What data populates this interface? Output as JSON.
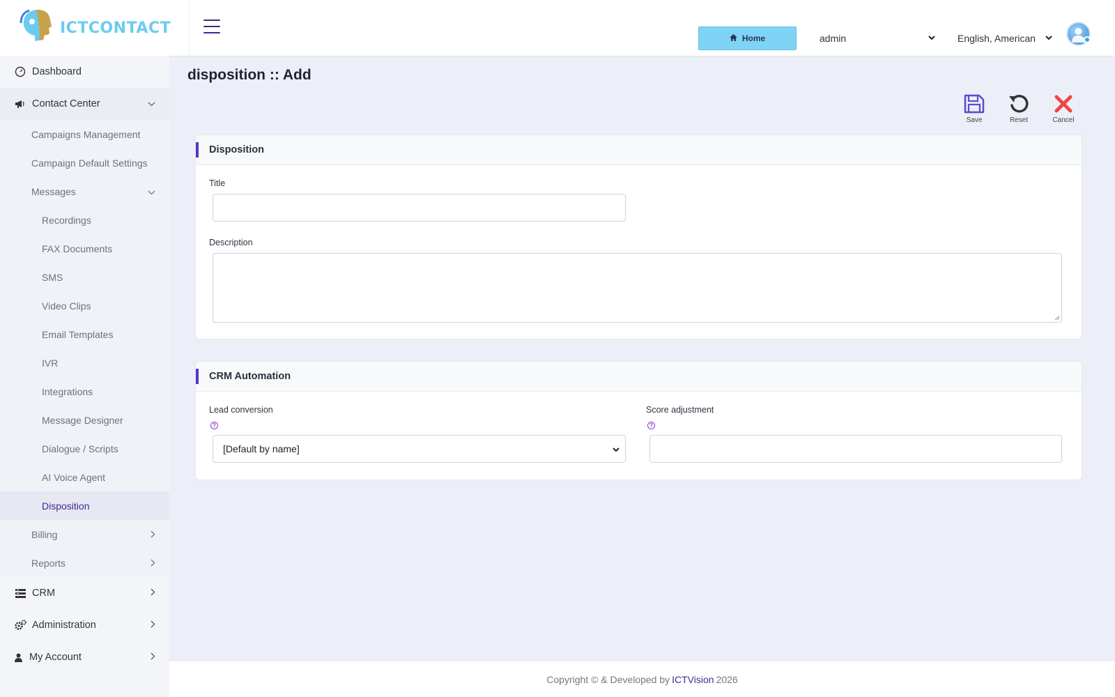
{
  "brand": {
    "name": "ICTCONTACT",
    "color": "#6ccbf2"
  },
  "accent_color": "#5b34c9",
  "sidebar": {
    "items": [
      {
        "label": "Dashboard",
        "icon": "dashboard-icon"
      },
      {
        "label": "Contact Center",
        "icon": "megaphone-icon"
      }
    ],
    "contact_center": {
      "campaigns_management": "Campaigns Management",
      "campaign_default_settings": "Campaign Default Settings",
      "messages": "Messages",
      "messages_items": [
        "Recordings",
        "FAX Documents",
        "SMS",
        "Video Clips",
        "Email Templates",
        "IVR",
        "Integrations",
        "Message Designer",
        "Dialogue / Scripts",
        "AI Voice Agent",
        "Disposition"
      ],
      "billing": "Billing",
      "reports": "Reports"
    },
    "bottom_items": [
      {
        "label": "CRM",
        "icon": "crm-icon"
      },
      {
        "label": "Administration",
        "icon": "gears-icon"
      },
      {
        "label": "My Account",
        "icon": "user-icon"
      }
    ]
  },
  "topbar": {
    "home_label": "Home",
    "user_select": "admin",
    "language_select": "English, American"
  },
  "page": {
    "title": "disposition :: Add",
    "actions": {
      "save": "Save",
      "reset": "Reset",
      "cancel": "Cancel"
    }
  },
  "disposition_card": {
    "heading": "Disposition",
    "title_label": "Title",
    "title_value": "",
    "description_label": "Description",
    "description_value": ""
  },
  "crm_card": {
    "heading": "CRM Automation",
    "lead_conversion_label": "Lead conversion",
    "lead_conversion_value": "[Default by name]",
    "score_adjustment_label": "Score adjustment",
    "score_adjustment_value": ""
  },
  "footer": {
    "prefix": "Copyright © & Developed by",
    "link": "ICTVision",
    "year": "2026"
  }
}
